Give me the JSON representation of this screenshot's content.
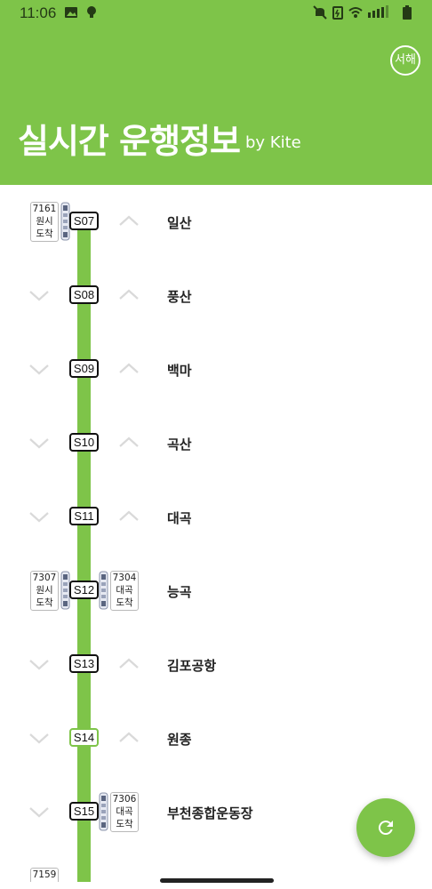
{
  "status_bar": {
    "time": "11:06",
    "icons": [
      "image-icon",
      "bulb-icon",
      "mute-icon",
      "battery-saver-icon",
      "wifi-icon",
      "signal-icon",
      "battery-icon"
    ]
  },
  "header": {
    "title": "실시간 운행정보",
    "subtitle": "by Kite",
    "line_toggle_label": "서해",
    "background_color": "#7ec449"
  },
  "stations": [
    {
      "code": "S07",
      "name": "일산",
      "code_style": "dark",
      "show_down": false,
      "show_up": true,
      "trains": [
        {
          "side": "left",
          "number": "7161",
          "dest": "원시",
          "status": "도착"
        }
      ]
    },
    {
      "code": "S08",
      "name": "풍산",
      "code_style": "dark",
      "show_down": true,
      "show_up": true,
      "trains": []
    },
    {
      "code": "S09",
      "name": "백마",
      "code_style": "dark",
      "show_down": true,
      "show_up": true,
      "trains": []
    },
    {
      "code": "S10",
      "name": "곡산",
      "code_style": "dark",
      "show_down": true,
      "show_up": true,
      "trains": []
    },
    {
      "code": "S11",
      "name": "대곡",
      "code_style": "dark",
      "show_down": true,
      "show_up": true,
      "trains": []
    },
    {
      "code": "S12",
      "name": "능곡",
      "code_style": "dark",
      "show_down": false,
      "show_up": false,
      "trains": [
        {
          "side": "left",
          "number": "7307",
          "dest": "원시",
          "status": "도착"
        },
        {
          "side": "right",
          "number": "7304",
          "dest": "대곡",
          "status": "도착"
        }
      ]
    },
    {
      "code": "S13",
      "name": "김포공항",
      "code_style": "dark",
      "show_down": true,
      "show_up": true,
      "trains": []
    },
    {
      "code": "S14",
      "name": "원종",
      "code_style": "light",
      "show_down": true,
      "show_up": true,
      "trains": []
    },
    {
      "code": "S15",
      "name": "부천종합운동장",
      "code_style": "dark",
      "show_down": true,
      "show_up": false,
      "trains": [
        {
          "side": "right",
          "number": "7306",
          "dest": "대곡",
          "status": "도착"
        }
      ]
    }
  ],
  "partial_next_train": {
    "number": "7159"
  },
  "refresh_button": {
    "icon": "refresh-icon"
  }
}
